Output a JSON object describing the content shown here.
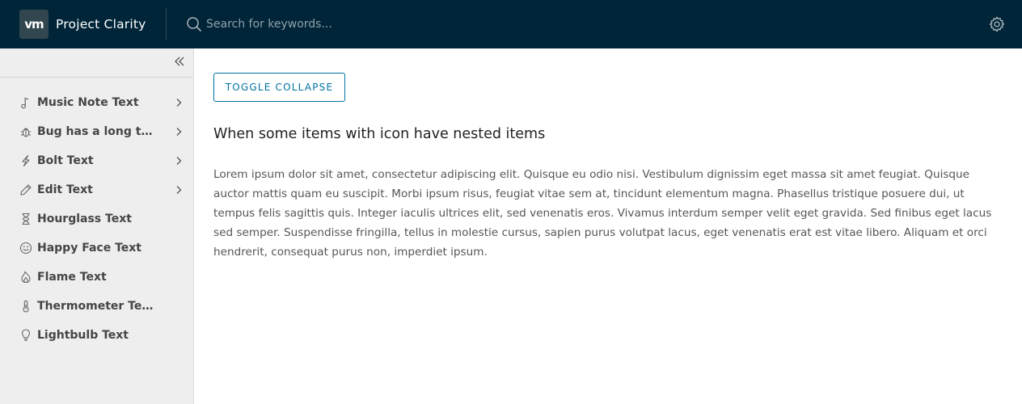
{
  "header": {
    "logo_text": "vm",
    "app_title": "Project Clarity",
    "search": {
      "placeholder": "Search for keywords..."
    },
    "icons": {
      "search": "search-icon",
      "settings": "gear-icon"
    }
  },
  "sidebar": {
    "collapse_icon": "double-chevron-left-icon",
    "items": [
      {
        "label": "Music Note Text",
        "icon": "music-note-icon",
        "has_children": true
      },
      {
        "label": "Bug has a long text...",
        "icon": "bug-icon",
        "has_children": true
      },
      {
        "label": "Bolt Text",
        "icon": "bolt-icon",
        "has_children": true
      },
      {
        "label": "Edit Text",
        "icon": "pencil-icon",
        "has_children": true
      },
      {
        "label": "Hourglass Text",
        "icon": "hourglass-icon",
        "has_children": false
      },
      {
        "label": "Happy Face Text",
        "icon": "happy-face-icon",
        "has_children": false
      },
      {
        "label": "Flame Text",
        "icon": "flame-icon",
        "has_children": false
      },
      {
        "label": "Thermometer Text",
        "icon": "thermometer-icon",
        "has_children": false
      },
      {
        "label": "Lightbulb Text",
        "icon": "lightbulb-icon",
        "has_children": false
      }
    ]
  },
  "main": {
    "toggle_button_label": "TOGGLE COLLAPSE",
    "heading": "When some items with icon have nested items",
    "body": "Lorem ipsum dolor sit amet, consectetur adipiscing elit. Quisque eu odio nisi. Vestibulum dignissim eget massa sit amet feugiat. Quisque auctor mattis quam eu suscipit. Morbi ipsum risus, feugiat vitae sem at, tincidunt elementum magna. Phasellus tristique posuere dui, ut tempus felis sagittis quis. Integer iaculis ultrices elit, sed venenatis eros. Vivamus interdum semper velit eget gravida. Sed finibus eget lacus sed semper. Suspendisse fringilla, tellus in molestie cursus, sapien purus volutpat lacus, eget venenatis erat est vitae libero. Aliquam et orci hendrerit, consequat purus non, imperdiet ipsum."
  },
  "colors": {
    "header_bg": "#002538",
    "sidebar_bg": "#eeeeee",
    "accent": "#0072a3",
    "nav_text": "#454545"
  }
}
